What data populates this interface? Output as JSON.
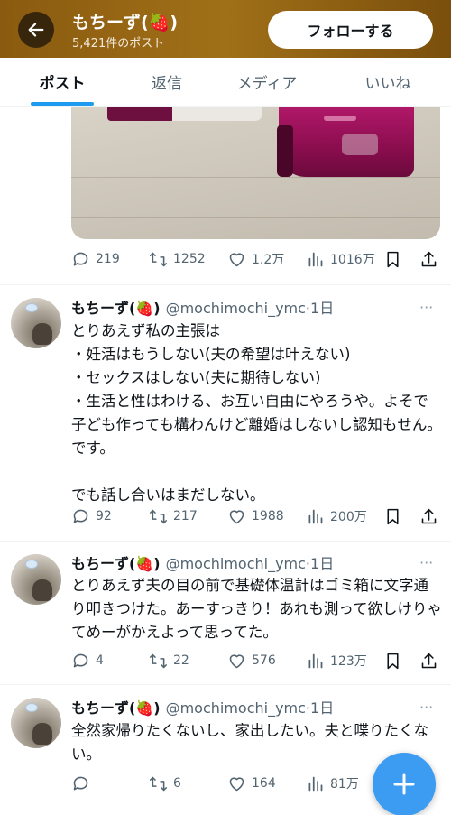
{
  "header": {
    "name": "もちーず(🍓)",
    "post_count": "5,421件のポスト",
    "follow_label": "フォローする"
  },
  "tabs": [
    {
      "label": "ポスト",
      "active": true
    },
    {
      "label": "返信",
      "active": false
    },
    {
      "label": "メディア",
      "active": false
    },
    {
      "label": "いいね",
      "active": false
    }
  ],
  "tweets": [
    {
      "has_media": true,
      "replies": "219",
      "reposts": "1252",
      "likes": "1.2万",
      "views": "1016万"
    },
    {
      "name": "もちーず(🍓)",
      "handle": "@mochimochi_ymc·1日",
      "text": "とりあえず私の主張は\n・妊活はもうしない(夫の希望は叶えない)\n・セックスはしない(夫に期待しない)\n・生活と性はわける、お互い自由にやろうや。よそで子ども作っても構わんけど離婚はしないし認知もせん。です。\n\nでも話し合いはまだしない。",
      "replies": "92",
      "reposts": "217",
      "likes": "1988",
      "views": "200万"
    },
    {
      "name": "もちーず(🍓)",
      "handle": "@mochimochi_ymc·1日",
      "text": "とりあえず夫の目の前で基礎体温計はゴミ箱に文字通り叩きつけた。あーすっきり！あれも測って欲しけりゃてめーがかえよって思ってた。",
      "replies": "4",
      "reposts": "22",
      "likes": "576",
      "views": "123万"
    },
    {
      "name": "もちーず(🍓)",
      "handle": "@mochimochi_ymc·1日",
      "text": "全然家帰りたくないし、家出したい。夫と喋りたくない。",
      "replies": "",
      "reposts": "6",
      "likes": "164",
      "views": "81万"
    }
  ],
  "more_icon": "···",
  "colors": {
    "accent": "#1d9bf0",
    "fab": "#3b9cf2",
    "header": "#8a5a10"
  }
}
